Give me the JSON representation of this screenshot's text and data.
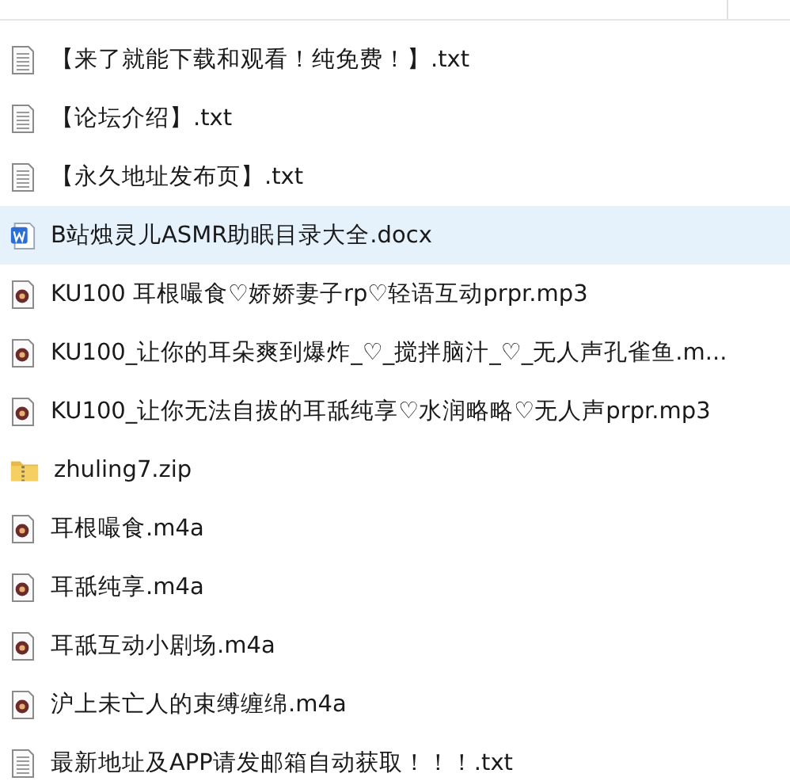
{
  "files": [
    {
      "name": "【来了就能下载和观看！纯免费！】.txt",
      "kind": "text",
      "selected": false
    },
    {
      "name": "【论坛介绍】.txt",
      "kind": "text",
      "selected": false
    },
    {
      "name": "【永久地址发布页】.txt",
      "kind": "text",
      "selected": false
    },
    {
      "name": "B站烛灵儿ASMR助眠目录大全.docx",
      "kind": "word",
      "selected": true
    },
    {
      "name": "KU100  耳根嘬食♡娇娇妻子rp♡轻语互动prpr.mp3",
      "kind": "audio",
      "selected": false
    },
    {
      "name": "KU100_让你的耳朵爽到爆炸_♡_搅拌脑汁_♡_无人声孔雀鱼.m...",
      "kind": "audio",
      "selected": false
    },
    {
      "name": "KU100_让你无法自拔的耳舐纯享♡水润略略♡无人声prpr.mp3",
      "kind": "audio",
      "selected": false
    },
    {
      "name": "zhuling7.zip",
      "kind": "zip",
      "selected": false
    },
    {
      "name": "耳根嘬食.m4a",
      "kind": "audio",
      "selected": false
    },
    {
      "name": "耳舐纯享.m4a",
      "kind": "audio",
      "selected": false
    },
    {
      "name": "耳舐互动小剧场.m4a",
      "kind": "audio",
      "selected": false
    },
    {
      "name": "沪上未亡人的束缚缠绵.m4a",
      "kind": "audio",
      "selected": false
    },
    {
      "name": "最新地址及APP请发邮箱自动获取！！！.txt",
      "kind": "text",
      "selected": false
    }
  ]
}
